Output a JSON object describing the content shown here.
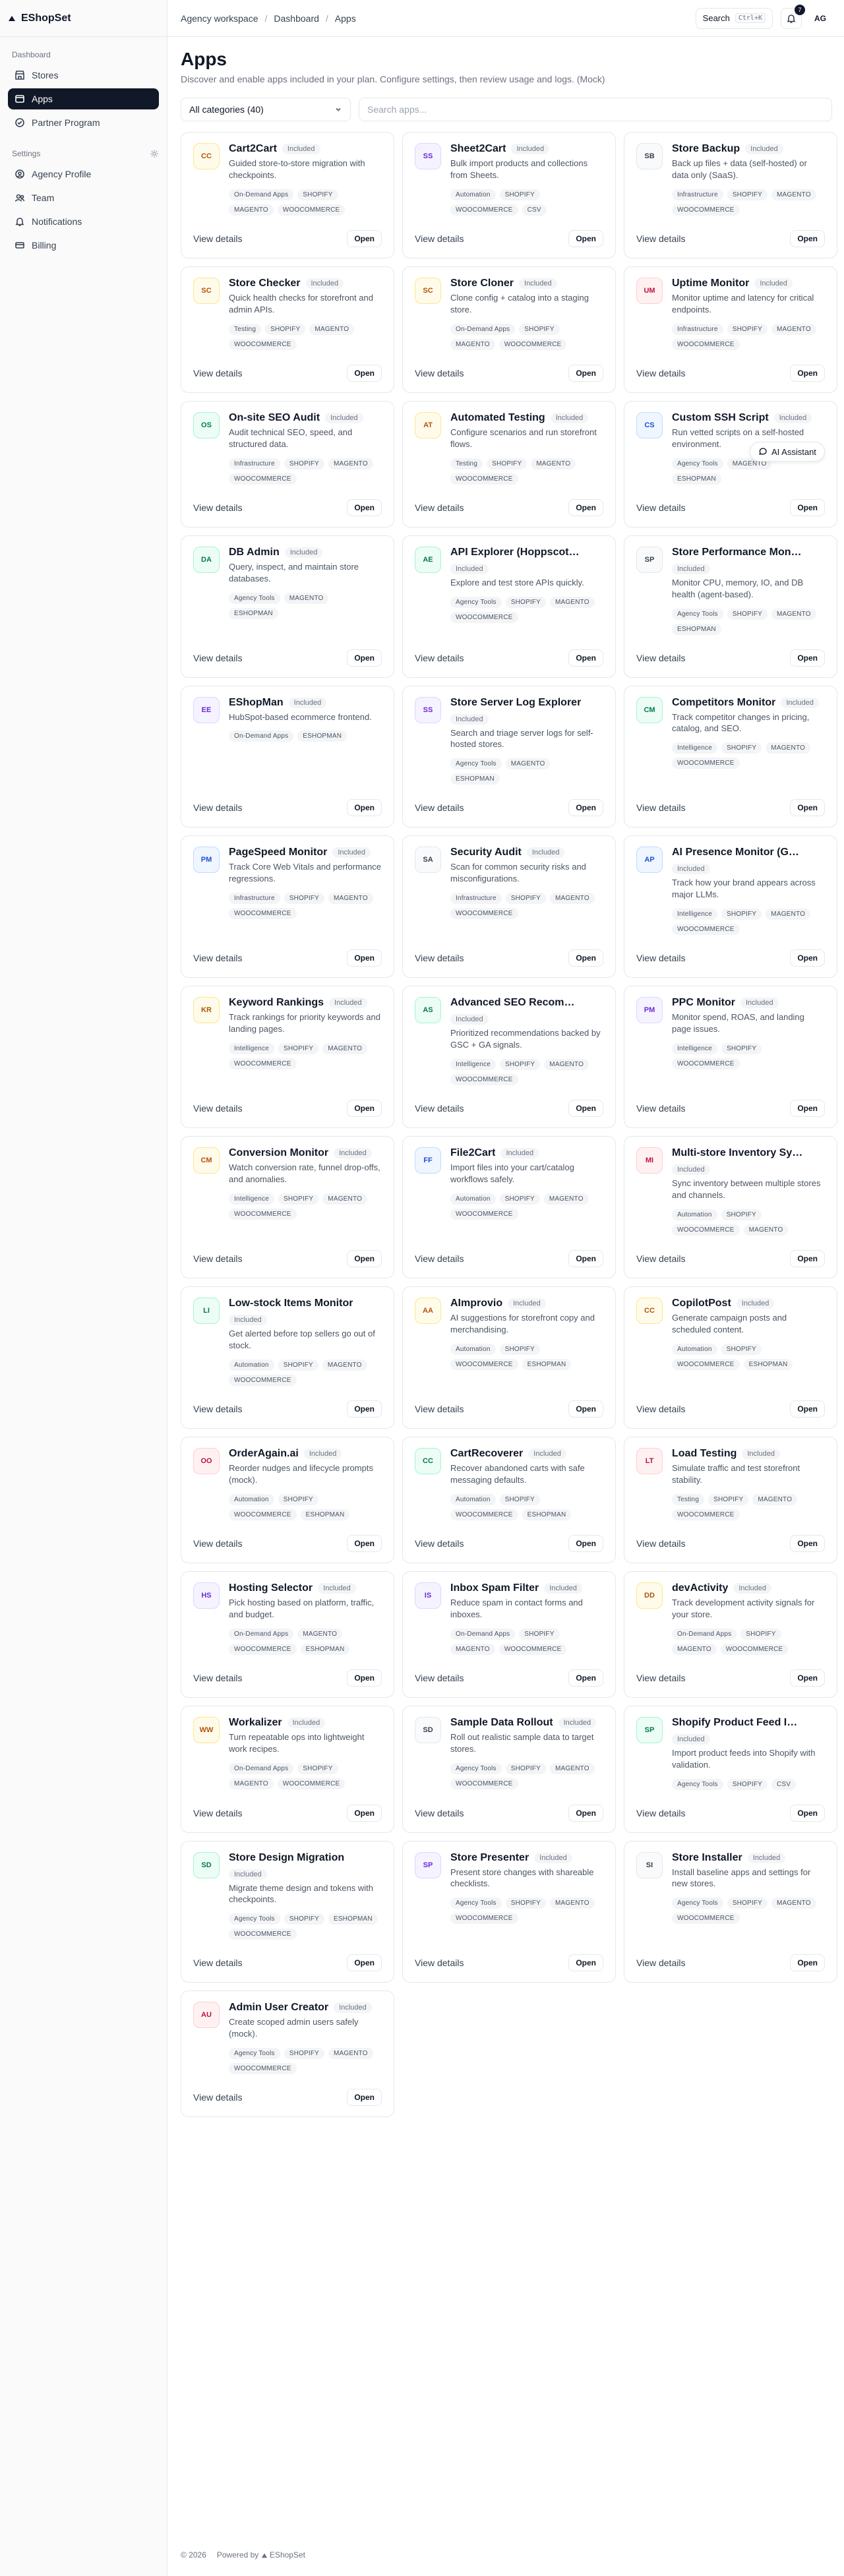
{
  "brand": {
    "name": "EShopSet"
  },
  "sidebar": {
    "sections": [
      {
        "label": "Dashboard",
        "items": [
          {
            "label": "Stores",
            "icon": "store-icon"
          },
          {
            "label": "Apps",
            "icon": "apps-icon",
            "active": true
          },
          {
            "label": "Partner Program",
            "icon": "partner-icon"
          }
        ]
      },
      {
        "label": "Settings",
        "items": [
          {
            "label": "Agency Profile",
            "icon": "profile-icon"
          },
          {
            "label": "Team",
            "icon": "team-icon"
          },
          {
            "label": "Notifications",
            "icon": "bell-icon"
          },
          {
            "label": "Billing",
            "icon": "billing-icon"
          }
        ]
      }
    ]
  },
  "header": {
    "breadcrumb": [
      "Agency workspace",
      "Dashboard",
      "Apps"
    ],
    "search_label": "Search",
    "search_shortcut": "Ctrl+K",
    "notification_count": "7",
    "avatar_initials": "AG"
  },
  "page": {
    "title": "Apps",
    "subtitle": "Discover and enable apps included in your plan. Configure settings, then review usage and logs. (Mock)"
  },
  "filters": {
    "category": "All categories (40)",
    "search_placeholder": "Search apps..."
  },
  "ai_assistant_label": "AI Assistant",
  "card_labels": {
    "included": "Included",
    "view_details": "View details",
    "open": "Open"
  },
  "colors": {
    "orange": {
      "fg": "#c2410c",
      "bg": "#fff7ed",
      "border": "#fed7aa"
    },
    "violet": {
      "fg": "#6d28d9",
      "bg": "#f5f3ff",
      "border": "#ddd6fe"
    },
    "gray": {
      "fg": "#374151",
      "bg": "#f9fafb",
      "border": "#e5e7eb"
    },
    "amber": {
      "fg": "#b45309",
      "bg": "#fffbeb",
      "border": "#fde68a"
    },
    "rose": {
      "fg": "#be123c",
      "bg": "#fff1f2",
      "border": "#fecdd3"
    },
    "green": {
      "fg": "#047857",
      "bg": "#ecfdf5",
      "border": "#a7f3d0"
    },
    "blue": {
      "fg": "#1d4ed8",
      "bg": "#eff6ff",
      "border": "#bfdbfe"
    }
  },
  "apps": [
    {
      "abbr": "CC",
      "color": "amber",
      "name": "Cart2Cart",
      "desc": "Guided store-to-store migration with checkpoints.",
      "tags": [
        "On-Demand Apps",
        "SHOPIFY",
        "MAGENTO",
        "WOOCOMMERCE"
      ]
    },
    {
      "abbr": "SS",
      "color": "violet",
      "name": "Sheet2Cart",
      "desc": "Bulk import products and collections from Sheets.",
      "tags": [
        "Automation",
        "SHOPIFY",
        "WOOCOMMERCE",
        "CSV"
      ]
    },
    {
      "abbr": "SB",
      "color": "gray",
      "name": "Store Backup",
      "desc": "Back up files + data (self-hosted) or data only (SaaS).",
      "tags": [
        "Infrastructure",
        "SHOPIFY",
        "MAGENTO",
        "WOOCOMMERCE"
      ]
    },
    {
      "abbr": "SC",
      "color": "amber",
      "name": "Store Checker",
      "desc": "Quick health checks for storefront and admin APIs.",
      "tags": [
        "Testing",
        "SHOPIFY",
        "MAGENTO",
        "WOOCOMMERCE"
      ]
    },
    {
      "abbr": "SC",
      "color": "amber",
      "name": "Store Cloner",
      "desc": "Clone config + catalog into a staging store.",
      "tags": [
        "On-Demand Apps",
        "SHOPIFY",
        "MAGENTO",
        "WOOCOMMERCE"
      ]
    },
    {
      "abbr": "UM",
      "color": "rose",
      "name": "Uptime Monitor",
      "desc": "Monitor uptime and latency for critical endpoints.",
      "tags": [
        "Infrastructure",
        "SHOPIFY",
        "MAGENTO",
        "WOOCOMMERCE"
      ]
    },
    {
      "abbr": "OS",
      "color": "green",
      "name": "On-site SEO Audit",
      "desc": "Audit technical SEO, speed, and structured data.",
      "tags": [
        "Infrastructure",
        "SHOPIFY",
        "MAGENTO",
        "WOOCOMMERCE"
      ]
    },
    {
      "abbr": "AT",
      "color": "amber",
      "name": "Automated Testing",
      "desc": "Configure scenarios and run storefront flows.",
      "tags": [
        "Testing",
        "SHOPIFY",
        "MAGENTO",
        "WOOCOMMERCE"
      ]
    },
    {
      "abbr": "CS",
      "color": "blue",
      "name": "Custom SSH Script",
      "desc": "Run vetted scripts on a self-hosted environment.",
      "tags": [
        "Agency Tools",
        "MAGENTO",
        "ESHOPMAN"
      ]
    },
    {
      "abbr": "DA",
      "color": "green",
      "name": "DB Admin",
      "desc": "Query, inspect, and maintain store databases.",
      "tags": [
        "Agency Tools",
        "MAGENTO",
        "ESHOPMAN"
      ]
    },
    {
      "abbr": "AE",
      "color": "green",
      "name": "API Explorer (Hoppscotch)",
      "desc": "Explore and test store APIs quickly.",
      "tags": [
        "Agency Tools",
        "SHOPIFY",
        "MAGENTO",
        "WOOCOMMERCE"
      ]
    },
    {
      "abbr": "SP",
      "color": "gray",
      "name": "Store Performance Monitor",
      "desc": "Monitor CPU, memory, IO, and DB health (agent-based).",
      "tags": [
        "Agency Tools",
        "SHOPIFY",
        "MAGENTO",
        "ESHOPMAN"
      ]
    },
    {
      "abbr": "EE",
      "color": "violet",
      "name": "EShopMan",
      "desc": "HubSpot-based ecommerce frontend.",
      "tags": [
        "On-Demand Apps",
        "ESHOPMAN"
      ]
    },
    {
      "abbr": "SS",
      "color": "violet",
      "name": "Store Server Log Explorer",
      "desc": "Search and triage server logs for self-hosted stores.",
      "tags": [
        "Agency Tools",
        "MAGENTO",
        "ESHOPMAN"
      ]
    },
    {
      "abbr": "CM",
      "color": "green",
      "name": "Competitors Monitor",
      "desc": "Track competitor changes in pricing, catalog, and SEO.",
      "tags": [
        "Intelligence",
        "SHOPIFY",
        "MAGENTO",
        "WOOCOMMERCE"
      ]
    },
    {
      "abbr": "PM",
      "color": "blue",
      "name": "PageSpeed Monitor",
      "desc": "Track Core Web Vitals and performance regressions.",
      "tags": [
        "Infrastructure",
        "SHOPIFY",
        "MAGENTO",
        "WOOCOMMERCE"
      ]
    },
    {
      "abbr": "SA",
      "color": "gray",
      "name": "Security Audit",
      "desc": "Scan for common security risks and misconfigurations.",
      "tags": [
        "Infrastructure",
        "SHOPIFY",
        "MAGENTO",
        "WOOCOMMERCE"
      ]
    },
    {
      "abbr": "AP",
      "color": "blue",
      "name": "AI Presence Monitor (GEO)",
      "desc": "Track how your brand appears across major LLMs.",
      "tags": [
        "Intelligence",
        "SHOPIFY",
        "MAGENTO",
        "WOOCOMMERCE"
      ]
    },
    {
      "abbr": "KR",
      "color": "amber",
      "name": "Keyword Rankings",
      "desc": "Track rankings for priority keywords and landing pages.",
      "tags": [
        "Intelligence",
        "SHOPIFY",
        "MAGENTO",
        "WOOCOMMERCE"
      ]
    },
    {
      "abbr": "AS",
      "color": "green",
      "name": "Advanced SEO Recommendations",
      "desc": "Prioritized recommendations backed by GSC + GA signals.",
      "tags": [
        "Intelligence",
        "SHOPIFY",
        "MAGENTO",
        "WOOCOMMERCE"
      ]
    },
    {
      "abbr": "PM",
      "color": "violet",
      "name": "PPC Monitor",
      "desc": "Monitor spend, ROAS, and landing page issues.",
      "tags": [
        "Intelligence",
        "SHOPIFY",
        "WOOCOMMERCE"
      ]
    },
    {
      "abbr": "CM",
      "color": "amber",
      "name": "Conversion Monitor",
      "desc": "Watch conversion rate, funnel drop-offs, and anomalies.",
      "tags": [
        "Intelligence",
        "SHOPIFY",
        "MAGENTO",
        "WOOCOMMERCE"
      ]
    },
    {
      "abbr": "FF",
      "color": "blue",
      "name": "File2Cart",
      "desc": "Import files into your cart/catalog workflows safely.",
      "tags": [
        "Automation",
        "SHOPIFY",
        "MAGENTO",
        "WOOCOMMERCE"
      ]
    },
    {
      "abbr": "MI",
      "color": "rose",
      "name": "Multi-store Inventory Sync",
      "desc": "Sync inventory between multiple stores and channels.",
      "tags": [
        "Automation",
        "SHOPIFY",
        "WOOCOMMERCE",
        "MAGENTO"
      ]
    },
    {
      "abbr": "LI",
      "color": "green",
      "name": "Low-stock Items Monitor",
      "desc": "Get alerted before top sellers go out of stock.",
      "tags": [
        "Automation",
        "SHOPIFY",
        "MAGENTO",
        "WOOCOMMERCE"
      ]
    },
    {
      "abbr": "AA",
      "color": "amber",
      "name": "AImprovio",
      "desc": "AI suggestions for storefront copy and merchandising.",
      "tags": [
        "Automation",
        "SHOPIFY",
        "WOOCOMMERCE",
        "ESHOPMAN"
      ]
    },
    {
      "abbr": "CC",
      "color": "amber",
      "name": "CopilotPost",
      "desc": "Generate campaign posts and scheduled content.",
      "tags": [
        "Automation",
        "SHOPIFY",
        "WOOCOMMERCE",
        "ESHOPMAN"
      ]
    },
    {
      "abbr": "OO",
      "color": "rose",
      "name": "OrderAgain.ai",
      "desc": "Reorder nudges and lifecycle prompts (mock).",
      "tags": [
        "Automation",
        "SHOPIFY",
        "WOOCOMMERCE",
        "ESHOPMAN"
      ]
    },
    {
      "abbr": "CC",
      "color": "green",
      "name": "CartRecoverer",
      "desc": "Recover abandoned carts with safe messaging defaults.",
      "tags": [
        "Automation",
        "SHOPIFY",
        "WOOCOMMERCE",
        "ESHOPMAN"
      ]
    },
    {
      "abbr": "LT",
      "color": "rose",
      "name": "Load Testing",
      "desc": "Simulate traffic and test storefront stability.",
      "tags": [
        "Testing",
        "SHOPIFY",
        "MAGENTO",
        "WOOCOMMERCE"
      ]
    },
    {
      "abbr": "HS",
      "color": "violet",
      "name": "Hosting Selector",
      "desc": "Pick hosting based on platform, traffic, and budget.",
      "tags": [
        "On-Demand Apps",
        "MAGENTO",
        "WOOCOMMERCE",
        "ESHOPMAN"
      ]
    },
    {
      "abbr": "IS",
      "color": "violet",
      "name": "Inbox Spam Filter",
      "desc": "Reduce spam in contact forms and inboxes.",
      "tags": [
        "On-Demand Apps",
        "SHOPIFY",
        "MAGENTO",
        "WOOCOMMERCE"
      ]
    },
    {
      "abbr": "DD",
      "color": "amber",
      "name": "devActivity",
      "desc": "Track development activity signals for your store.",
      "tags": [
        "On-Demand Apps",
        "SHOPIFY",
        "MAGENTO",
        "WOOCOMMERCE"
      ]
    },
    {
      "abbr": "WW",
      "color": "amber",
      "name": "Workalizer",
      "desc": "Turn repeatable ops into lightweight work recipes.",
      "tags": [
        "On-Demand Apps",
        "SHOPIFY",
        "MAGENTO",
        "WOOCOMMERCE"
      ]
    },
    {
      "abbr": "SD",
      "color": "gray",
      "name": "Sample Data Rollout",
      "desc": "Roll out realistic sample data to target stores.",
      "tags": [
        "Agency Tools",
        "SHOPIFY",
        "MAGENTO",
        "WOOCOMMERCE"
      ]
    },
    {
      "abbr": "SP",
      "color": "green",
      "name": "Shopify Product Feed Importer",
      "desc": "Import product feeds into Shopify with validation.",
      "tags": [
        "Agency Tools",
        "SHOPIFY",
        "CSV"
      ]
    },
    {
      "abbr": "SD",
      "color": "green",
      "name": "Store Design Migration",
      "desc": "Migrate theme design and tokens with checkpoints.",
      "tags": [
        "Agency Tools",
        "SHOPIFY",
        "ESHOPMAN",
        "WOOCOMMERCE"
      ]
    },
    {
      "abbr": "SP",
      "color": "violet",
      "name": "Store Presenter",
      "desc": "Present store changes with shareable checklists.",
      "tags": [
        "Agency Tools",
        "SHOPIFY",
        "MAGENTO",
        "WOOCOMMERCE"
      ]
    },
    {
      "abbr": "SI",
      "color": "gray",
      "name": "Store Installer",
      "desc": "Install baseline apps and settings for new stores.",
      "tags": [
        "Agency Tools",
        "SHOPIFY",
        "MAGENTO",
        "WOOCOMMERCE"
      ]
    },
    {
      "abbr": "AU",
      "color": "rose",
      "name": "Admin User Creator",
      "desc": "Create scoped admin users safely (mock).",
      "tags": [
        "Agency Tools",
        "SHOPIFY",
        "MAGENTO",
        "WOOCOMMERCE"
      ]
    }
  ],
  "footer": {
    "copyright": "© 2026",
    "powered_by": "Powered by",
    "brand": "EShopSet"
  }
}
